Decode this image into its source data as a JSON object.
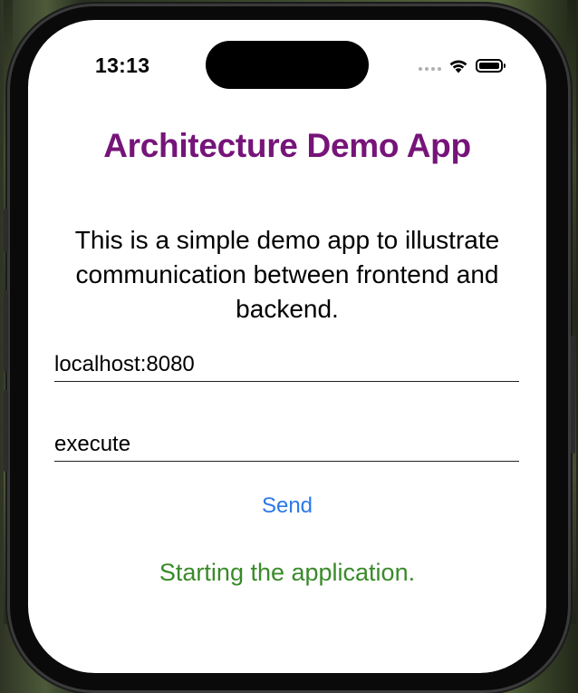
{
  "status_bar": {
    "time": "13:13"
  },
  "app": {
    "title": "Architecture Demo App",
    "description": "This is a simple demo app to illustrate communication between frontend and backend.",
    "host_field": {
      "value": "localhost:8080"
    },
    "command_field": {
      "value": "execute"
    },
    "send_label": "Send",
    "status_text": "Starting the application."
  },
  "colors": {
    "title": "#761479",
    "link": "#2c79e8",
    "status": "#3a8a2a"
  },
  "icons": [
    "signal-dots-icon",
    "wifi-icon",
    "battery-icon"
  ]
}
